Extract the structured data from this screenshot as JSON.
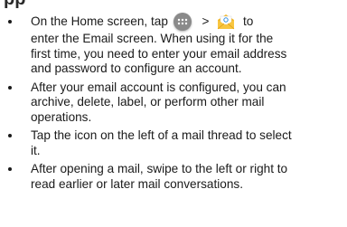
{
  "heading": "pp",
  "bullets": [
    {
      "lines": [
        {
          "before": "On the Home screen, tap",
          "gt": ">",
          "after": "to"
        },
        "enter the Email screen. When using it for the",
        "first time, you need to enter your email address",
        "and password to configure an account."
      ],
      "icons": [
        "apps-icon",
        "email-icon"
      ]
    },
    {
      "lines": [
        "After your email account is configured, you can",
        "archive, delete, label, or perform other mail",
        "operations."
      ]
    },
    {
      "lines": [
        "Tap the icon on the left of a mail thread to select",
        "it."
      ]
    },
    {
      "lines": [
        "After opening a mail, swipe to the left or right to",
        "read earlier or later mail conversations."
      ]
    }
  ]
}
